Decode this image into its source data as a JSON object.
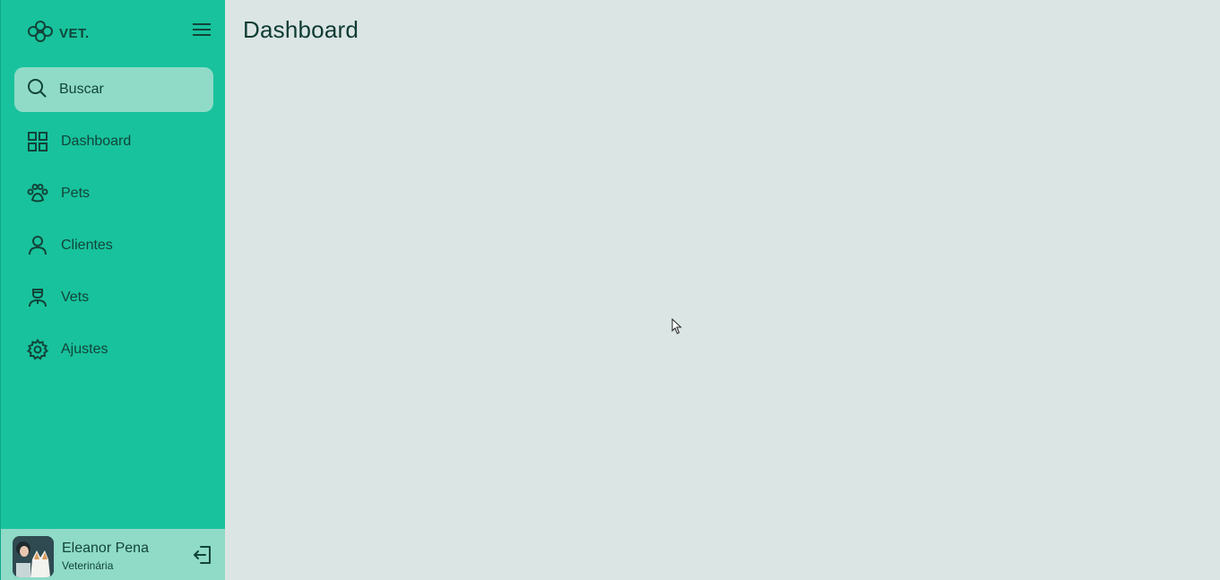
{
  "brand": {
    "name": "VET.",
    "logo_icon": "paw-cluster-icon"
  },
  "search": {
    "placeholder": "Buscar"
  },
  "sidebar": {
    "items": [
      {
        "label": "Dashboard",
        "icon": "grid-icon"
      },
      {
        "label": "Pets",
        "icon": "paw-icon"
      },
      {
        "label": "Clientes",
        "icon": "user-icon"
      },
      {
        "label": "Vets",
        "icon": "doctor-icon"
      },
      {
        "label": "Ajustes",
        "icon": "gear-icon"
      }
    ]
  },
  "profile": {
    "name": "Eleanor Pena",
    "role": "Veterinária"
  },
  "main": {
    "title": "Dashboard"
  },
  "colors": {
    "sidebar": "#18c29c",
    "highlight": "#8fdbc8",
    "background": "#dbe5e3",
    "text": "#12443a"
  }
}
